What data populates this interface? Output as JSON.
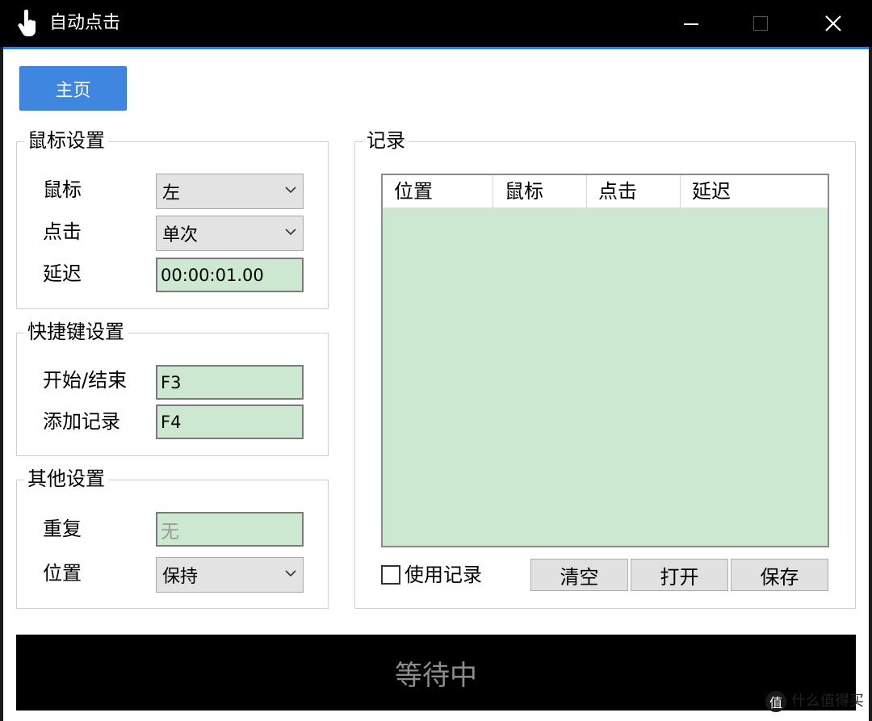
{
  "window": {
    "title": "自动点击",
    "icons": {
      "app": "hand-pointer-icon",
      "minimize": "minimize-icon",
      "maximize": "maximize-icon",
      "close": "close-icon"
    }
  },
  "tabs": {
    "main": "主页"
  },
  "mouse_settings": {
    "title": "鼠标设置",
    "mouse_label": "鼠标",
    "mouse_value": "左",
    "click_label": "点击",
    "click_value": "单次",
    "delay_label": "延迟",
    "delay_value": "00:00:01.00"
  },
  "hotkey_settings": {
    "title": "快捷键设置",
    "start_stop_label": "开始/结束",
    "start_stop_value": "F3",
    "add_record_label": "添加记录",
    "add_record_value": "F4"
  },
  "other_settings": {
    "title": "其他设置",
    "repeat_label": "重复",
    "repeat_value": "无",
    "position_label": "位置",
    "position_value": "保持"
  },
  "records": {
    "title": "记录",
    "columns": [
      "位置",
      "鼠标",
      "点击",
      "延迟"
    ],
    "rows": [],
    "use_record_label": "使用记录",
    "use_record_checked": false,
    "clear_button": "清空",
    "open_button": "打开",
    "save_button": "保存"
  },
  "status_text": "等待中",
  "watermark": {
    "text": "什么值得买",
    "icon": "zhi-logo-icon"
  },
  "colors": {
    "accent": "#3e86e0",
    "field_bg": "#cde8d0",
    "titlebar": "#000000"
  }
}
